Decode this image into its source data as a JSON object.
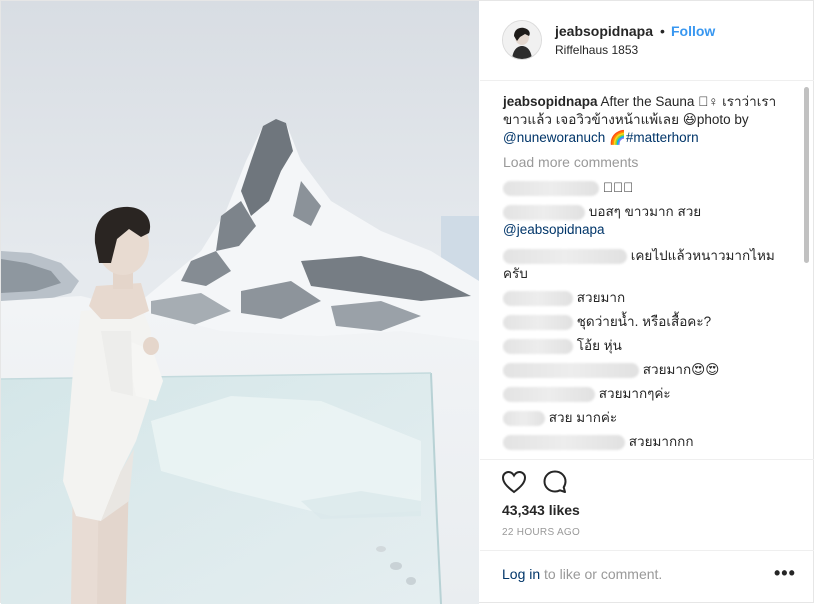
{
  "post": {
    "username": "jeabsopidnapa",
    "separator": "•",
    "follow_label": "Follow",
    "location": "Riffelhaus 1853",
    "caption": {
      "username": "jeabsopidnapa",
      "text_part1": "After the Sauna 🏻‍♀ เราว่าเราขาวแล้ว เจอวิวข้างหน้าแพ้เลย 😆photo by",
      "mention": "@nuneworanuch",
      "text_part2": " 🌈",
      "hashtag": "#matterhorn"
    },
    "load_more_label": "Load more comments",
    "comments": [
      {
        "text": "🏻🏻🏻"
      },
      {
        "text": "บอสๆ ขาวมาก สวย",
        "mention": "@jeabsopidnapa"
      },
      {
        "text": "เคยไปแล้วหนาวมากไหมครับ"
      },
      {
        "text": "สวยมาก"
      },
      {
        "text": "ชุดว่ายน้ำ. หรือเสื้อคะ?"
      },
      {
        "text": "โอ้ย หุ่น"
      },
      {
        "text": "สวยมาก😍😍"
      },
      {
        "text": "สวยมากๆค่ะ"
      },
      {
        "text": "สวย มากค่ะ"
      },
      {
        "text": "สวยมากกก"
      }
    ],
    "likes": "43,343 likes",
    "time_ago": "22 HOURS AGO",
    "login_link": "Log in",
    "login_rest": " to like or comment.",
    "more_label": "•••",
    "icons": {
      "like": "heart-icon",
      "comment": "comment-bubble-icon",
      "more": "more-options-icon"
    },
    "colors": {
      "link": "#003569",
      "follow": "#3897f0",
      "muted": "#999999"
    }
  }
}
